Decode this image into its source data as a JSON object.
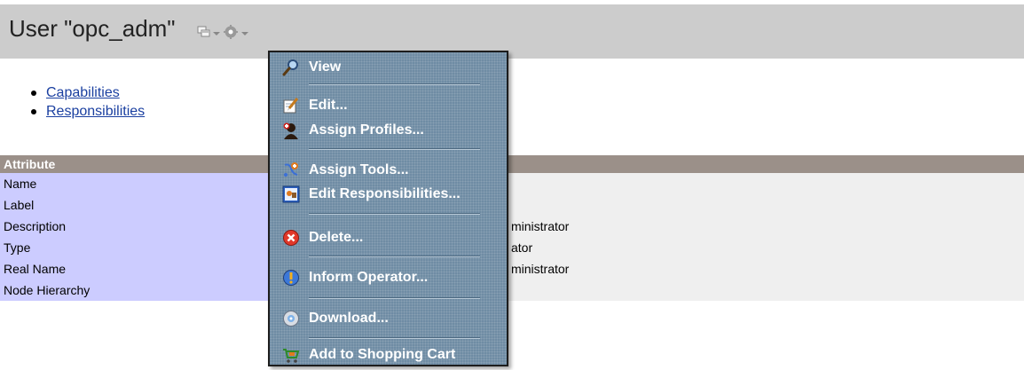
{
  "header": {
    "title": "User \"opc_adm\"",
    "icons": [
      "window-icon",
      "gear-icon"
    ]
  },
  "links": [
    {
      "label": "Capabilities"
    },
    {
      "label": "Responsibilities"
    }
  ],
  "table": {
    "header_label": "Attribute",
    "rows": [
      {
        "label": "Name",
        "value": ""
      },
      {
        "label": "Label",
        "value": ""
      },
      {
        "label": "Description",
        "value": "ministrator"
      },
      {
        "label": "Type",
        "value": "ator"
      },
      {
        "label": "Real Name",
        "value": "ministrator"
      },
      {
        "label": "Node Hierarchy",
        "value": ""
      }
    ]
  },
  "menu": {
    "items": [
      {
        "label": "View",
        "icon": "magnifier-icon"
      },
      {
        "label": "Edit...",
        "icon": "edit-icon"
      },
      {
        "label": "Assign Profiles...",
        "icon": "profile-icon"
      },
      {
        "label": "Assign Tools...",
        "icon": "tools-icon"
      },
      {
        "label": "Edit Responsibilities...",
        "icon": "responsibilities-icon"
      },
      {
        "label": "Delete...",
        "icon": "delete-icon"
      },
      {
        "label": "Inform Operator...",
        "icon": "inform-icon"
      },
      {
        "label": "Download...",
        "icon": "download-icon"
      },
      {
        "label": "Add to Shopping Cart",
        "icon": "cart-icon"
      }
    ]
  },
  "colors": {
    "header_bg": "#cccccc",
    "menu_bg": "#6f8ca4",
    "attribute_label_bg": "#ccccff",
    "attribute_value_bg": "#efefef",
    "table_header_bg": "#9b9089",
    "link": "#1a3fa0"
  }
}
